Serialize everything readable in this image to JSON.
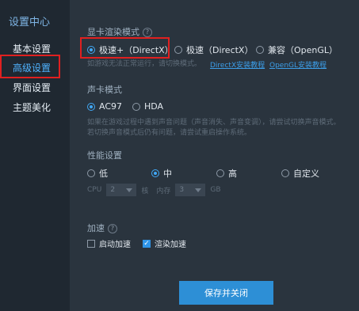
{
  "sidebar": {
    "title": "设置中心",
    "items": [
      {
        "label": "基本设置"
      },
      {
        "label": "高级设置"
      },
      {
        "label": "界面设置"
      },
      {
        "label": "主题美化"
      }
    ]
  },
  "gpu": {
    "title": "显卡渲染模式",
    "help": "?",
    "options": [
      {
        "label": "极速+（DirectX）"
      },
      {
        "label": "极速（DirectX）"
      },
      {
        "label": "兼容（OpenGL）"
      }
    ],
    "hint": "如游戏无法正常运行，请切换模式。",
    "link_directx": "DirectX安装教程",
    "link_opengl": "OpenGL安装教程"
  },
  "sound": {
    "title": "声卡模式",
    "options": [
      {
        "label": "AC97"
      },
      {
        "label": "HDA"
      }
    ],
    "hint_line1": "如果在游戏过程中遇到声音问题（声音消失、声音变调），请尝试切换声音模式。",
    "hint_line2": "若切换声音模式后仍有问题，请尝试重启操作系统。"
  },
  "performance": {
    "title": "性能设置",
    "options": [
      {
        "label": "低"
      },
      {
        "label": "中"
      },
      {
        "label": "高"
      },
      {
        "label": "自定义"
      }
    ],
    "cpu_label": "CPU",
    "cpu_value": "2",
    "cpu_unit": "核",
    "mem_label": "内存",
    "mem_value": "3",
    "mem_unit": "GB"
  },
  "accel": {
    "title": "加速",
    "help": "?",
    "startup": "启动加速",
    "render": "渲染加速"
  },
  "save_label": "保存并关闭"
}
